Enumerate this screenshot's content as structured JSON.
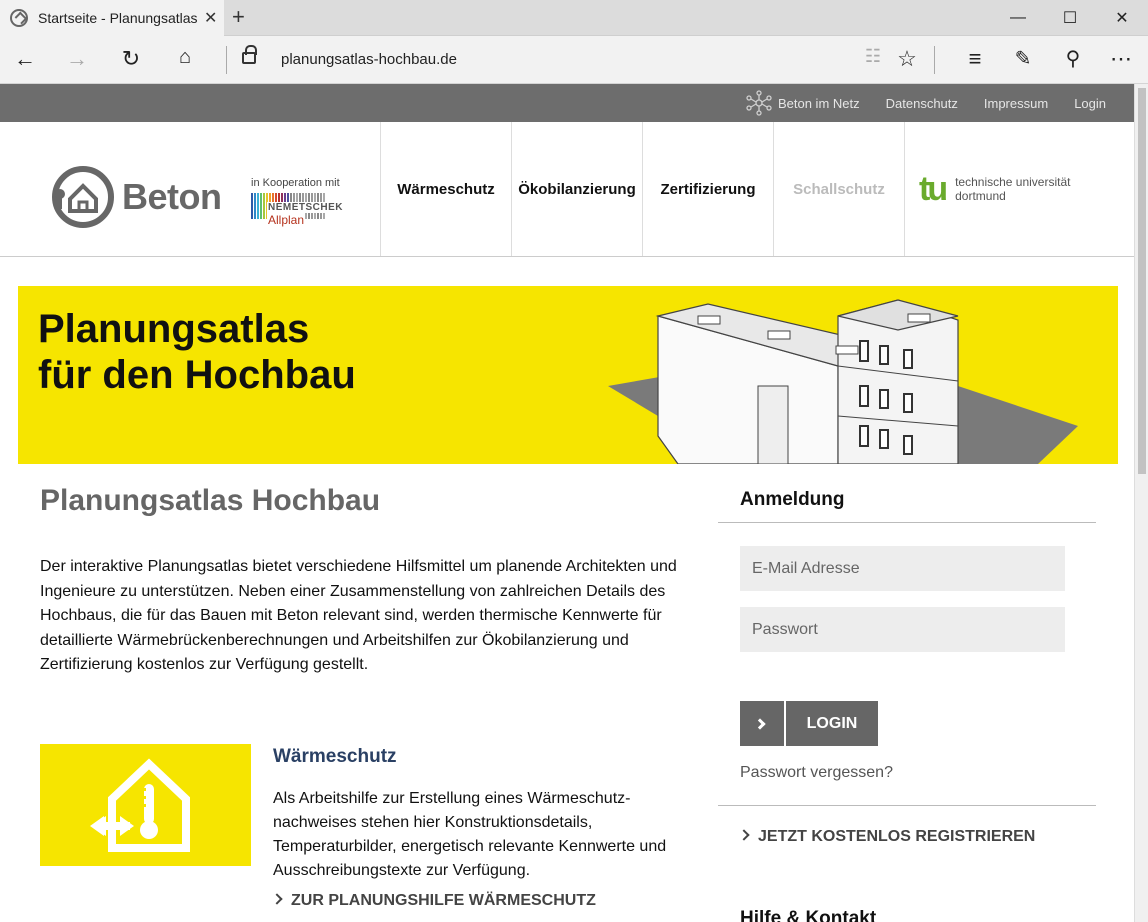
{
  "browser": {
    "tab_title": "Startseite - Planungsatlas",
    "url": "planungsatlas-hochbau.de",
    "icons": [
      "back-icon",
      "forward-icon",
      "refresh-icon",
      "home-icon",
      "lock-icon",
      "reading-view-icon",
      "favorite-star-icon",
      "hub-icon",
      "web-note-icon",
      "share-icon",
      "more-icon"
    ]
  },
  "topbar": {
    "links": [
      "Beton im Netz",
      "Datenschutz",
      "Impressum",
      "Login"
    ]
  },
  "header": {
    "logo_text": "Beton",
    "cooperation": "in Kooperation mit",
    "partner_name": "NEMETSCHEK",
    "partner_product": "Allplan",
    "nav": [
      "Wärmeschutz",
      "Ökobilanzierung",
      "Zertifizierung",
      "Schallschutz"
    ],
    "tu_mark": "tu",
    "tu_line1": "technische universität",
    "tu_line2": "dortmund"
  },
  "banner": {
    "line1": "Planungsatlas",
    "line2": "für den Hochbau"
  },
  "main": {
    "title": "Planungsatlas Hochbau",
    "intro": "Der interaktive Planungsatlas bietet verschiedene Hilfsmittel um planende Architekten und Ingenieure zu unterstützen. Neben einer Zusammenstellung von zahlreichen Details des Hochbaus, die für das Bauen mit Beton relevant sind, werden thermische Kennwerte für detaillierte Wärmebrückenberechnungen und Arbeitshilfen zur Ökobilanzierung und Zertifizierung kostenlos zur Verfügung gestellt.",
    "card": {
      "title": "Wärmeschutz",
      "text": "Als Arbeitshilfe zur Erstellung eines Wärmeschutz-nachweises stehen hier Konstruktionsdetails, Temperaturbilder, energetisch relevante Kennwerte und Ausschreibungstexte zur Verfügung.",
      "link": "ZUR PLANUNGSHILFE WÄRMESCHUTZ"
    }
  },
  "sidebar": {
    "login_title": "Anmeldung",
    "email_placeholder": "E-Mail Adresse",
    "password_placeholder": "Passwort",
    "login_button": "LOGIN",
    "forgot": "Passwort vergessen?",
    "register": "JETZT KOSTENLOS REGISTRIEREN",
    "help_title": "Hilfe & Kontakt"
  },
  "colors": {
    "accent_yellow": "#f6e500",
    "topbar_gray": "#6d6d6d",
    "tu_green": "#6aab2d",
    "link_blue": "#2a4064"
  }
}
